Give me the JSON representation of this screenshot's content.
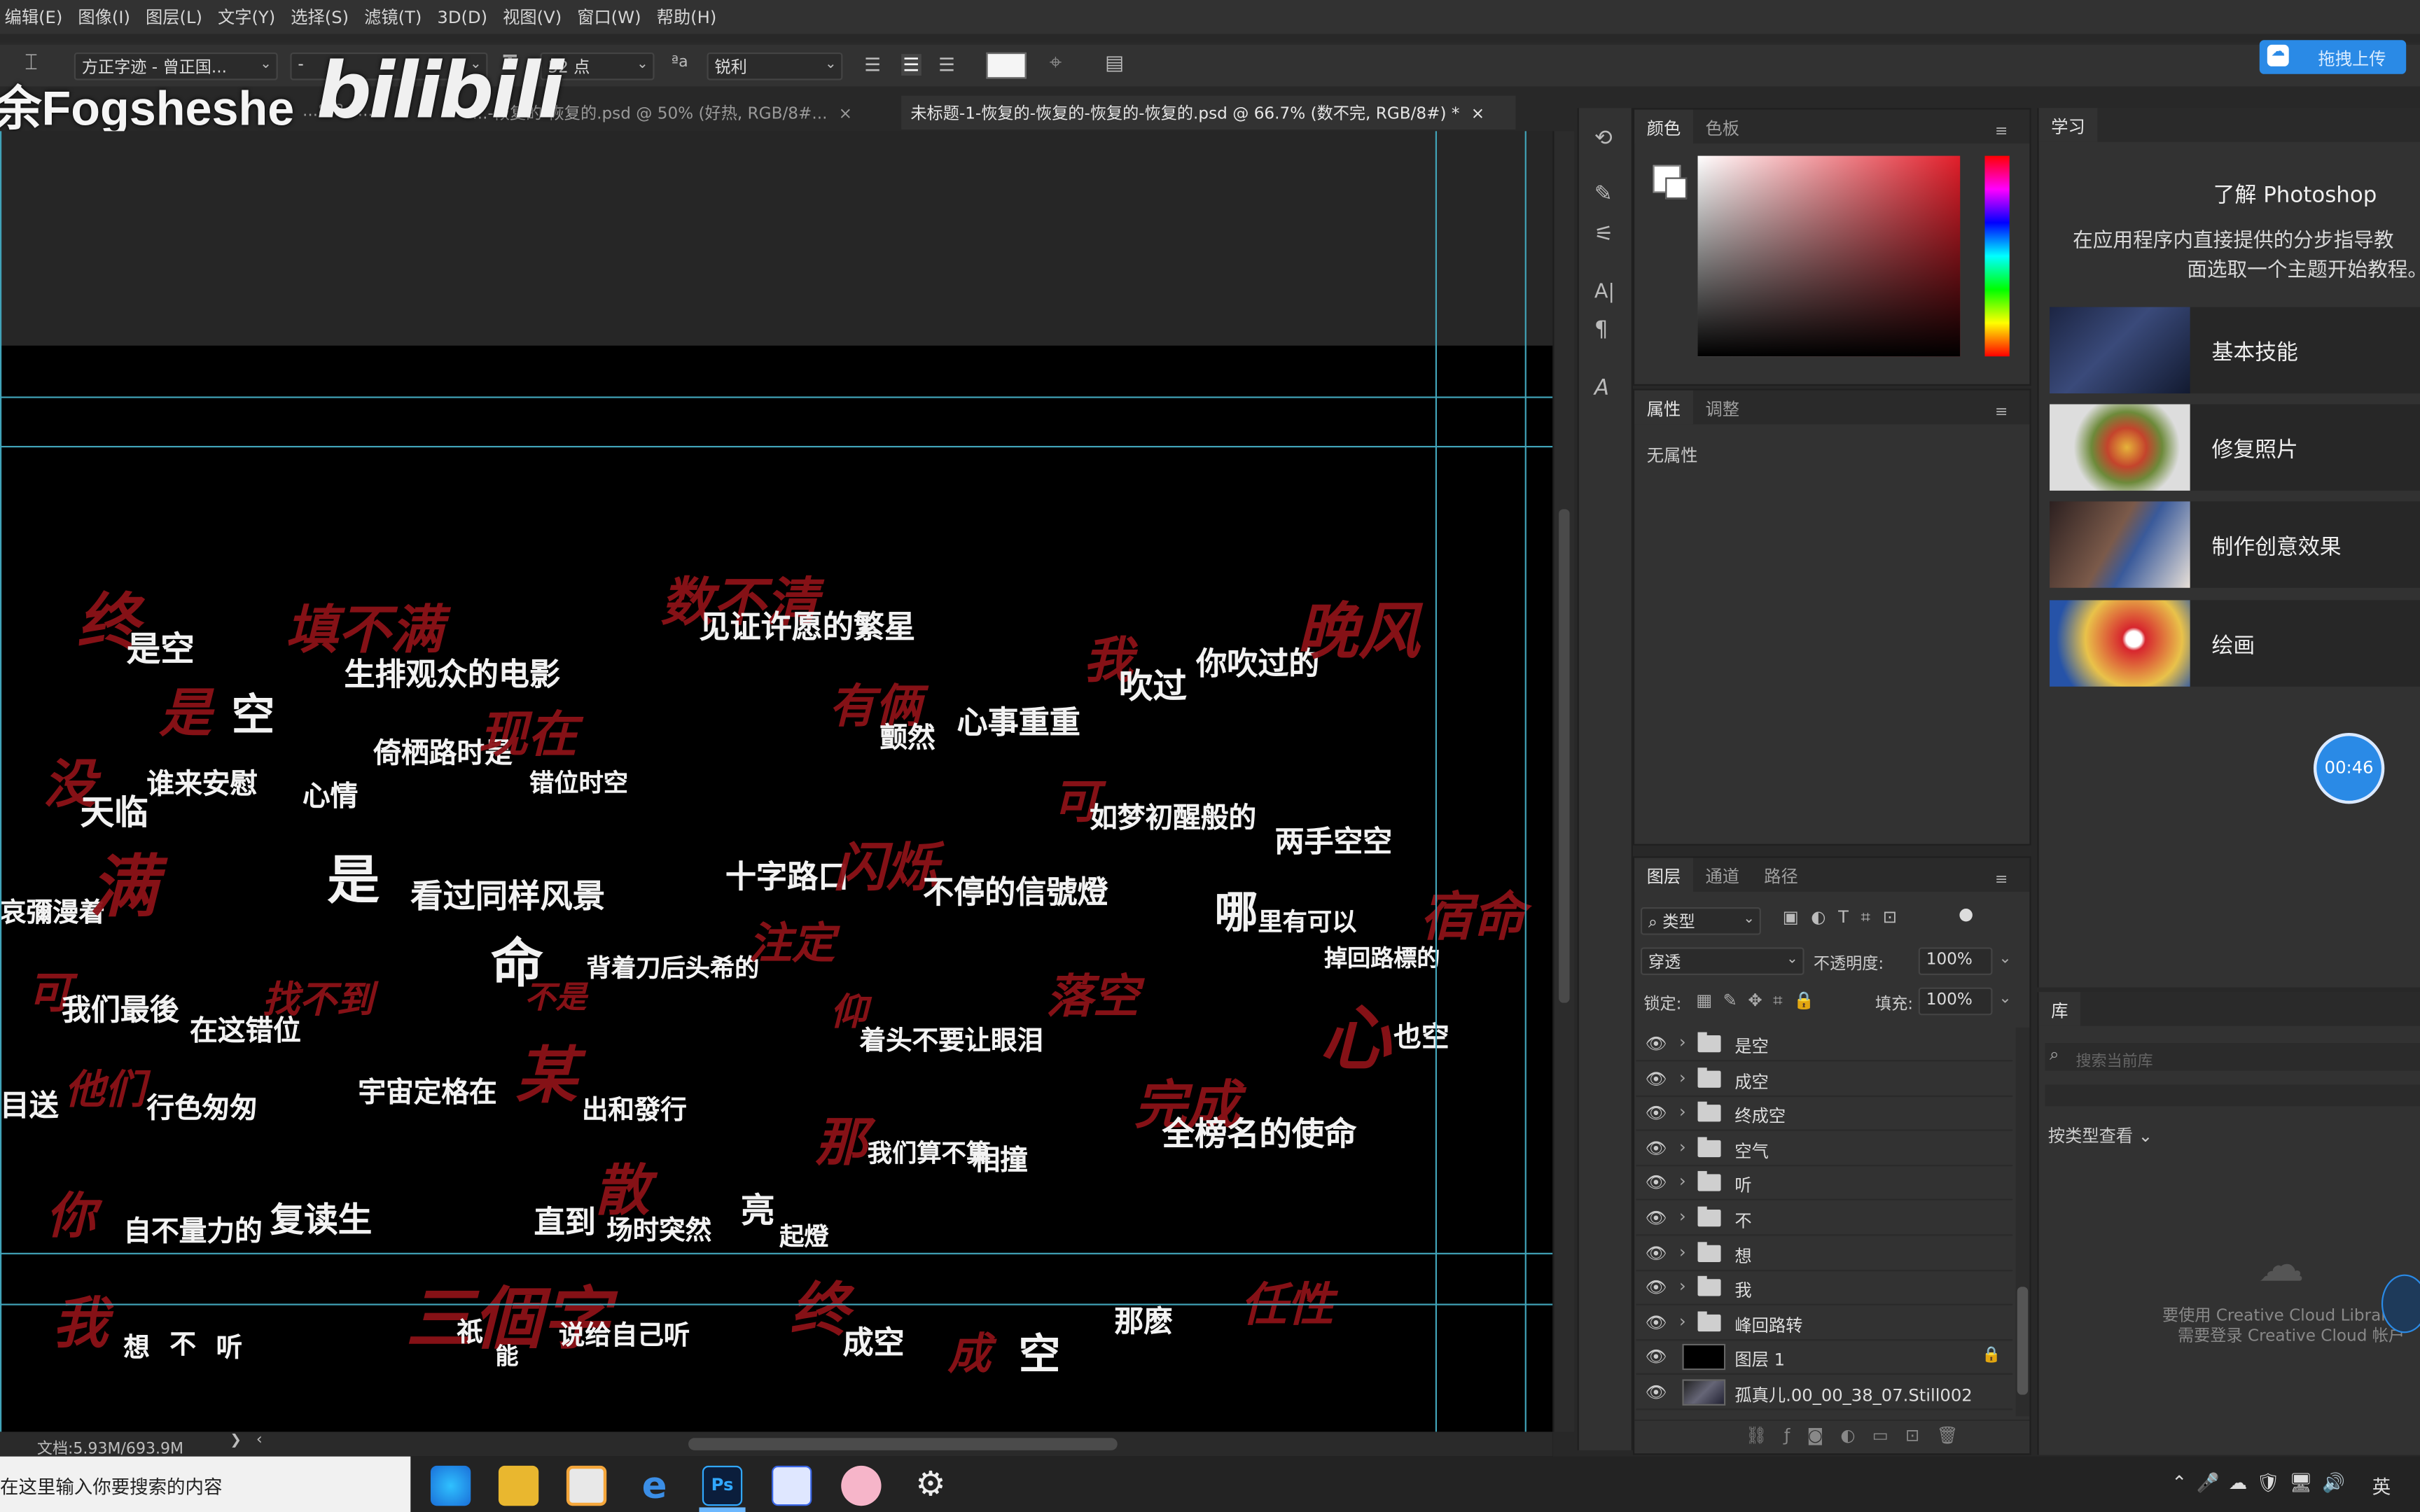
{
  "menu": [
    "编辑(E)",
    "图像(I)",
    "图层(L)",
    "文字(Y)",
    "选择(S)",
    "滤镜(T)",
    "3D(D)",
    "视图(V)",
    "窗口(W)",
    "帮助(H)"
  ],
  "options": {
    "font_family": "方正字迹 - 曾正国...",
    "font_style": "-",
    "font_size": "52 点",
    "aa_label": "aa",
    "antialias": "锐利",
    "upload_button": "拖拽上传"
  },
  "watermark": {
    "user": "余Fogsheshe",
    "logo": "bilibili"
  },
  "tabs": [
    "...8/8#...",
    "...-恢复的-恢复的.psd @ 50% (好热, RGB/8#...",
    "未标题-1-恢复的-恢复的-恢复的-恢复的.psd @ 66.7% (数不完, RGB/8#) *"
  ],
  "tab_close": "×",
  "status": {
    "doc": "文档:5.93M/693.9M",
    "arrow": "❯",
    "left_arrow": "‹"
  },
  "artwork": [
    {
      "t": "终",
      "c": "r"
    },
    {
      "t": "是空",
      "c": "w"
    },
    {
      "t": "填不满",
      "c": "r"
    },
    {
      "t": "生排观众的电影",
      "c": "w"
    },
    {
      "t": "数不清",
      "c": "r"
    },
    {
      "t": "见证许愿的繁星",
      "c": "w"
    },
    {
      "t": "我",
      "c": "r"
    },
    {
      "t": "吹过",
      "c": "w"
    },
    {
      "t": "你吹过的",
      "c": "w"
    },
    {
      "t": "晚风",
      "c": "r"
    },
    {
      "t": "是",
      "c": "r"
    },
    {
      "t": "空",
      "c": "w"
    },
    {
      "t": "倚栖路时是",
      "c": "w"
    },
    {
      "t": "现在",
      "c": "r"
    },
    {
      "t": "错位时空",
      "c": "w"
    },
    {
      "t": "有俩",
      "c": "r"
    },
    {
      "t": "颤然",
      "c": "w"
    },
    {
      "t": "心事重重",
      "c": "w"
    },
    {
      "t": "没",
      "c": "r"
    },
    {
      "t": "谁来安慰",
      "c": "w"
    },
    {
      "t": "心情",
      "c": "w"
    },
    {
      "t": "天临",
      "c": "w"
    },
    {
      "t": "可",
      "c": "r"
    },
    {
      "t": "如梦初醒般的",
      "c": "w"
    },
    {
      "t": "两手空空",
      "c": "w"
    },
    {
      "t": "哀彌漫着",
      "c": "w"
    },
    {
      "t": "满",
      "c": "r"
    },
    {
      "t": "是",
      "c": "w"
    },
    {
      "t": "看过同样风景",
      "c": "w"
    },
    {
      "t": "十字路口",
      "c": "w"
    },
    {
      "t": "闪烁",
      "c": "r"
    },
    {
      "t": "不停的信號燈",
      "c": "w"
    },
    {
      "t": "哪",
      "c": "w"
    },
    {
      "t": "里有可以",
      "c": "w"
    },
    {
      "t": "掉回路標的",
      "c": "w"
    },
    {
      "t": "宿命",
      "c": "r"
    },
    {
      "t": "命",
      "c": "w"
    },
    {
      "t": "不是",
      "c": "r"
    },
    {
      "t": "背着刀后头希的",
      "c": "w"
    },
    {
      "t": "注定",
      "c": "r"
    },
    {
      "t": "仰",
      "c": "r"
    },
    {
      "t": "着头不要让眼泪",
      "c": "w"
    },
    {
      "t": "落空",
      "c": "r"
    },
    {
      "t": "心",
      "c": "r"
    },
    {
      "t": "也空",
      "c": "w"
    },
    {
      "t": "可",
      "c": "r"
    },
    {
      "t": "我们最後",
      "c": "w"
    },
    {
      "t": "在这错位",
      "c": "w"
    },
    {
      "t": "找不到",
      "c": "r"
    },
    {
      "t": "目送",
      "c": "w"
    },
    {
      "t": "他们",
      "c": "r"
    },
    {
      "t": "行色匆匆",
      "c": "w"
    },
    {
      "t": "宇宙定格在",
      "c": "w"
    },
    {
      "t": "某",
      "c": "r"
    },
    {
      "t": "出和發行",
      "c": "w"
    },
    {
      "t": "那",
      "c": "r"
    },
    {
      "t": "我们算不算",
      "c": "w"
    },
    {
      "t": "相撞",
      "c": "w"
    },
    {
      "t": "完成",
      "c": "r"
    },
    {
      "t": "全榜名的使命",
      "c": "w"
    },
    {
      "t": "你",
      "c": "r"
    },
    {
      "t": "自不量力的",
      "c": "w"
    },
    {
      "t": "复读生",
      "c": "w"
    },
    {
      "t": "直到",
      "c": "w"
    },
    {
      "t": "散",
      "c": "r"
    },
    {
      "t": "场时突然",
      "c": "w"
    },
    {
      "t": "亮",
      "c": "w"
    },
    {
      "t": "起燈",
      "c": "w"
    },
    {
      "t": "我",
      "c": "r"
    },
    {
      "t": "想",
      "c": "w"
    },
    {
      "t": "不",
      "c": "w"
    },
    {
      "t": "听",
      "c": "w"
    },
    {
      "t": "三個字",
      "c": "r"
    },
    {
      "t": "祇",
      "c": "w"
    },
    {
      "t": "能",
      "c": "w"
    },
    {
      "t": "说给自己听",
      "c": "w"
    },
    {
      "t": "终",
      "c": "r"
    },
    {
      "t": "成空",
      "c": "w"
    },
    {
      "t": "成",
      "c": "r"
    },
    {
      "t": "空",
      "c": "w"
    },
    {
      "t": "那麽",
      "c": "w"
    },
    {
      "t": "任性",
      "c": "r"
    }
  ],
  "panels": {
    "color_tabs": [
      "颜色",
      "色板"
    ],
    "props_tabs": [
      "属性",
      "调整"
    ],
    "props_empty": "无属性",
    "layers_tabs": [
      "图层",
      "通道",
      "路径"
    ],
    "filter_kind": "类型",
    "blend_mode": "穿透",
    "opacity_label": "不透明度:",
    "opacity_value": "100%",
    "lock_label": "锁定:",
    "fill_label": "填充:",
    "fill_value": "100%",
    "layers": [
      "是空",
      "成空",
      "终成空",
      "空气",
      "听",
      "不",
      "想",
      "我",
      "峰回路转",
      "图层 1",
      "孤真儿.00_00_38_07.Still002"
    ],
    "menu_icon": "≡"
  },
  "learn": {
    "tab": "学习",
    "title": "了解 Photoshop",
    "desc1": "在应用程序内直接提供的分步指导教",
    "desc2": "面选取一个主题开始教程。",
    "cards": [
      "基本技能",
      "修复照片",
      "制作创意效果",
      "绘画"
    ],
    "timer": "00:46"
  },
  "library": {
    "tab": "库",
    "search_placeholder": "搜索当前库",
    "view_by": "按类型查看",
    "msg1": "要使用 Creative Cloud Librari",
    "msg2": "需要登录 Creative Cloud 帐户"
  },
  "taskbar": {
    "search": "在这里输入你要搜索的内容",
    "ime": "英",
    "ps_label": "Ps"
  },
  "colors": {
    "accent": "#2a8ae6",
    "guide": "#41a3b8",
    "red_art": "#8d1218"
  }
}
